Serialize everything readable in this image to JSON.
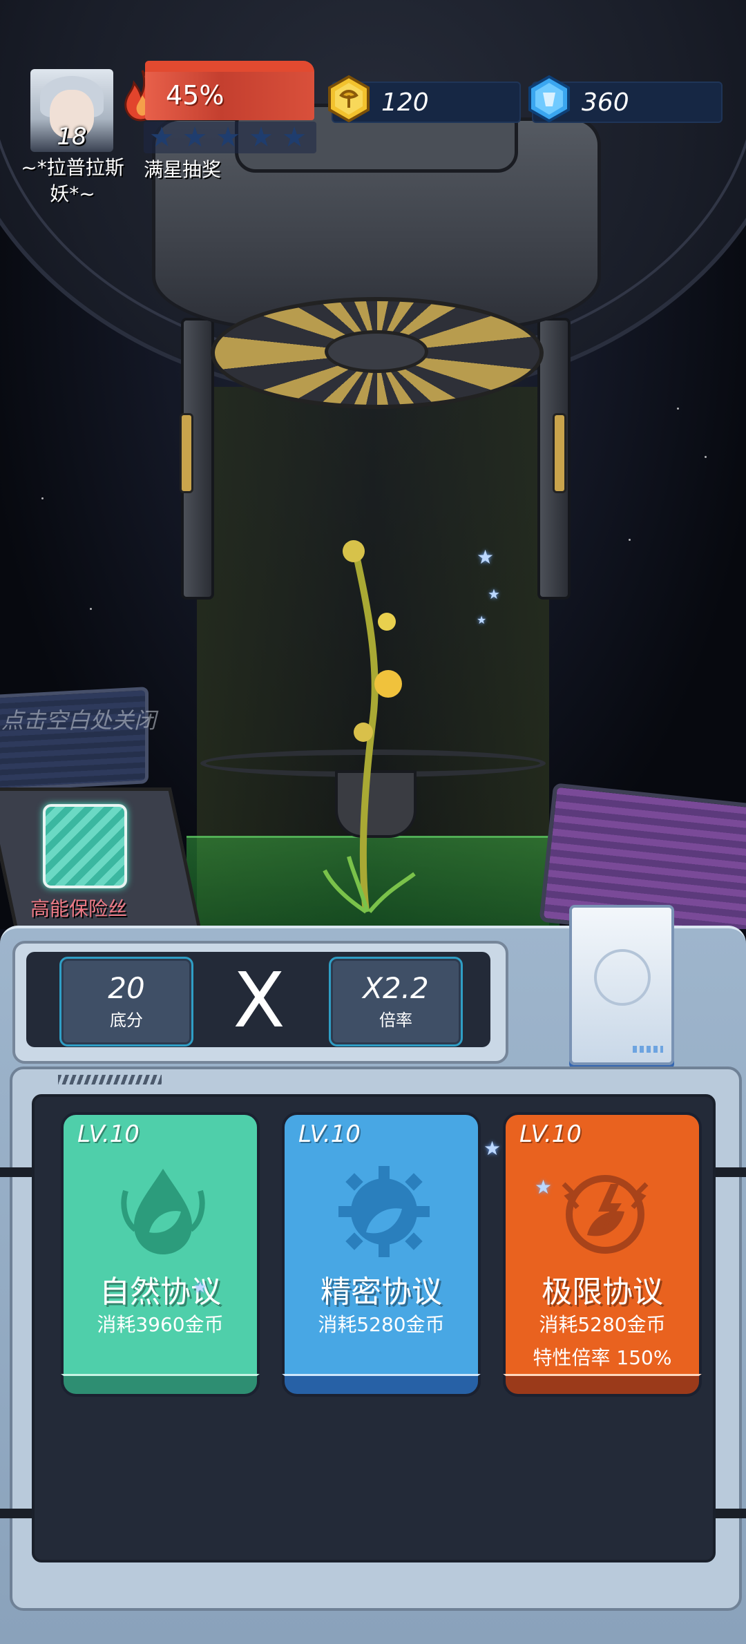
{
  "player": {
    "level": "18",
    "name": "~*拉普拉斯妖*~"
  },
  "hud": {
    "fire_percent": "45%",
    "fire_level": 0.45,
    "stars_filled": 0,
    "stars_total": 5,
    "star_label": "满星抽奖",
    "gold_value": "120",
    "gem_value": "360"
  },
  "scene": {
    "close_hint": "点击空白处关闭",
    "fuse_label": "高能保险丝"
  },
  "score": {
    "base_value": "20",
    "base_label": "底分",
    "operator": "X",
    "multiplier_value": "X2.2",
    "multiplier_label": "倍率"
  },
  "options": [
    {
      "level": "LV.10",
      "name": "自然协议",
      "cost": "消耗3960金币",
      "extra": ""
    },
    {
      "level": "LV.10",
      "name": "精密协议",
      "cost": "消耗5280金币",
      "extra": ""
    },
    {
      "level": "LV.10",
      "name": "极限协议",
      "cost": "消耗5280金币",
      "extra": "特性倍率 150%"
    }
  ],
  "colors": {
    "green": "#4fcfaa",
    "blue": "#48a7e4",
    "orange": "#e9621f",
    "fire": "#e24a30",
    "gold": "#f2c22e",
    "gem": "#3aa6f0"
  },
  "icons": {
    "fire": "fire-icon",
    "gold": "gold-coin-icon",
    "gem": "blue-gem-icon",
    "fuse": "fuse-icon",
    "deck": "card-deck-icon",
    "nature": "leaf-drop-icon",
    "precision": "gear-leaf-icon",
    "limit": "lightning-leaf-icon"
  }
}
